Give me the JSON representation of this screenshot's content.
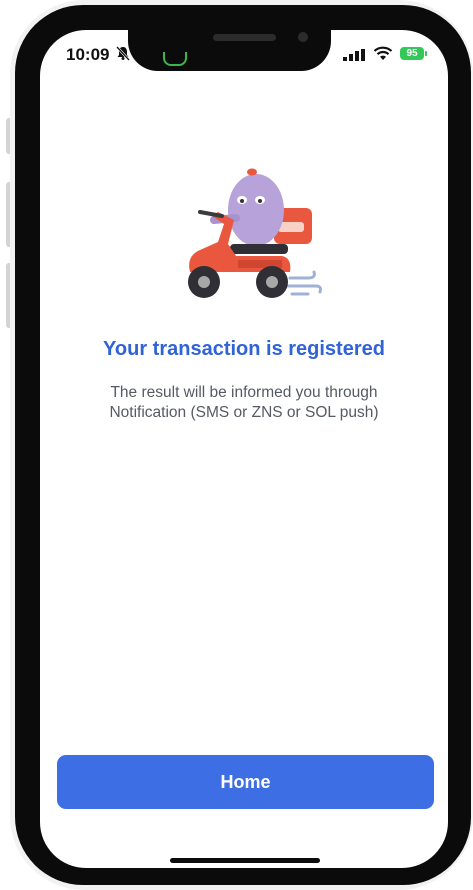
{
  "status_bar": {
    "time": "10:09",
    "battery": "95",
    "icons": [
      "silent-bell-icon",
      "signal-icon",
      "wifi-icon",
      "battery-icon"
    ]
  },
  "result": {
    "title": "Your transaction is registered",
    "description_line1": "The result will be informed you through",
    "description_line2": "Notification (SMS or ZNS or SOL push)"
  },
  "actions": {
    "home_label": "Home"
  },
  "colors": {
    "accent": "#3e6ee4",
    "title": "#2f63d6",
    "text": "#555a63"
  }
}
